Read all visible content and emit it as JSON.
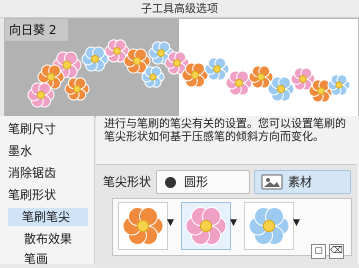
{
  "window": {
    "title": "子工具高级选项"
  },
  "preview": {
    "brush_name": "向日葵 2"
  },
  "sidebar": {
    "items": [
      {
        "label": "笔刷尺寸"
      },
      {
        "label": "墨水"
      },
      {
        "label": "消除锯齿"
      },
      {
        "label": "笔刷形状"
      },
      {
        "label": "笔刷笔尖"
      },
      {
        "label": "散布效果"
      },
      {
        "label": "笔画"
      }
    ]
  },
  "main": {
    "description": "进行与笔刷的笔尖有关的设置。您可以设置笔刷的笔尖形状如何基于压感笔的倾斜方向而变化。",
    "tip_shape_label": "笔尖形状",
    "round_option": "圆形",
    "material_option": "素材"
  },
  "icons": {
    "round": "filled-circle-icon",
    "material": "material-icon",
    "dropdown": "dropdown-arrow-icon",
    "new": "new-item-icon",
    "delete": "trash-icon"
  },
  "colors": {
    "flower_orange": "#f08a3c",
    "flower_pink": "#f0a0c4",
    "flower_blue": "#9ccaf0",
    "selected_bg": "#cfe4f7"
  }
}
